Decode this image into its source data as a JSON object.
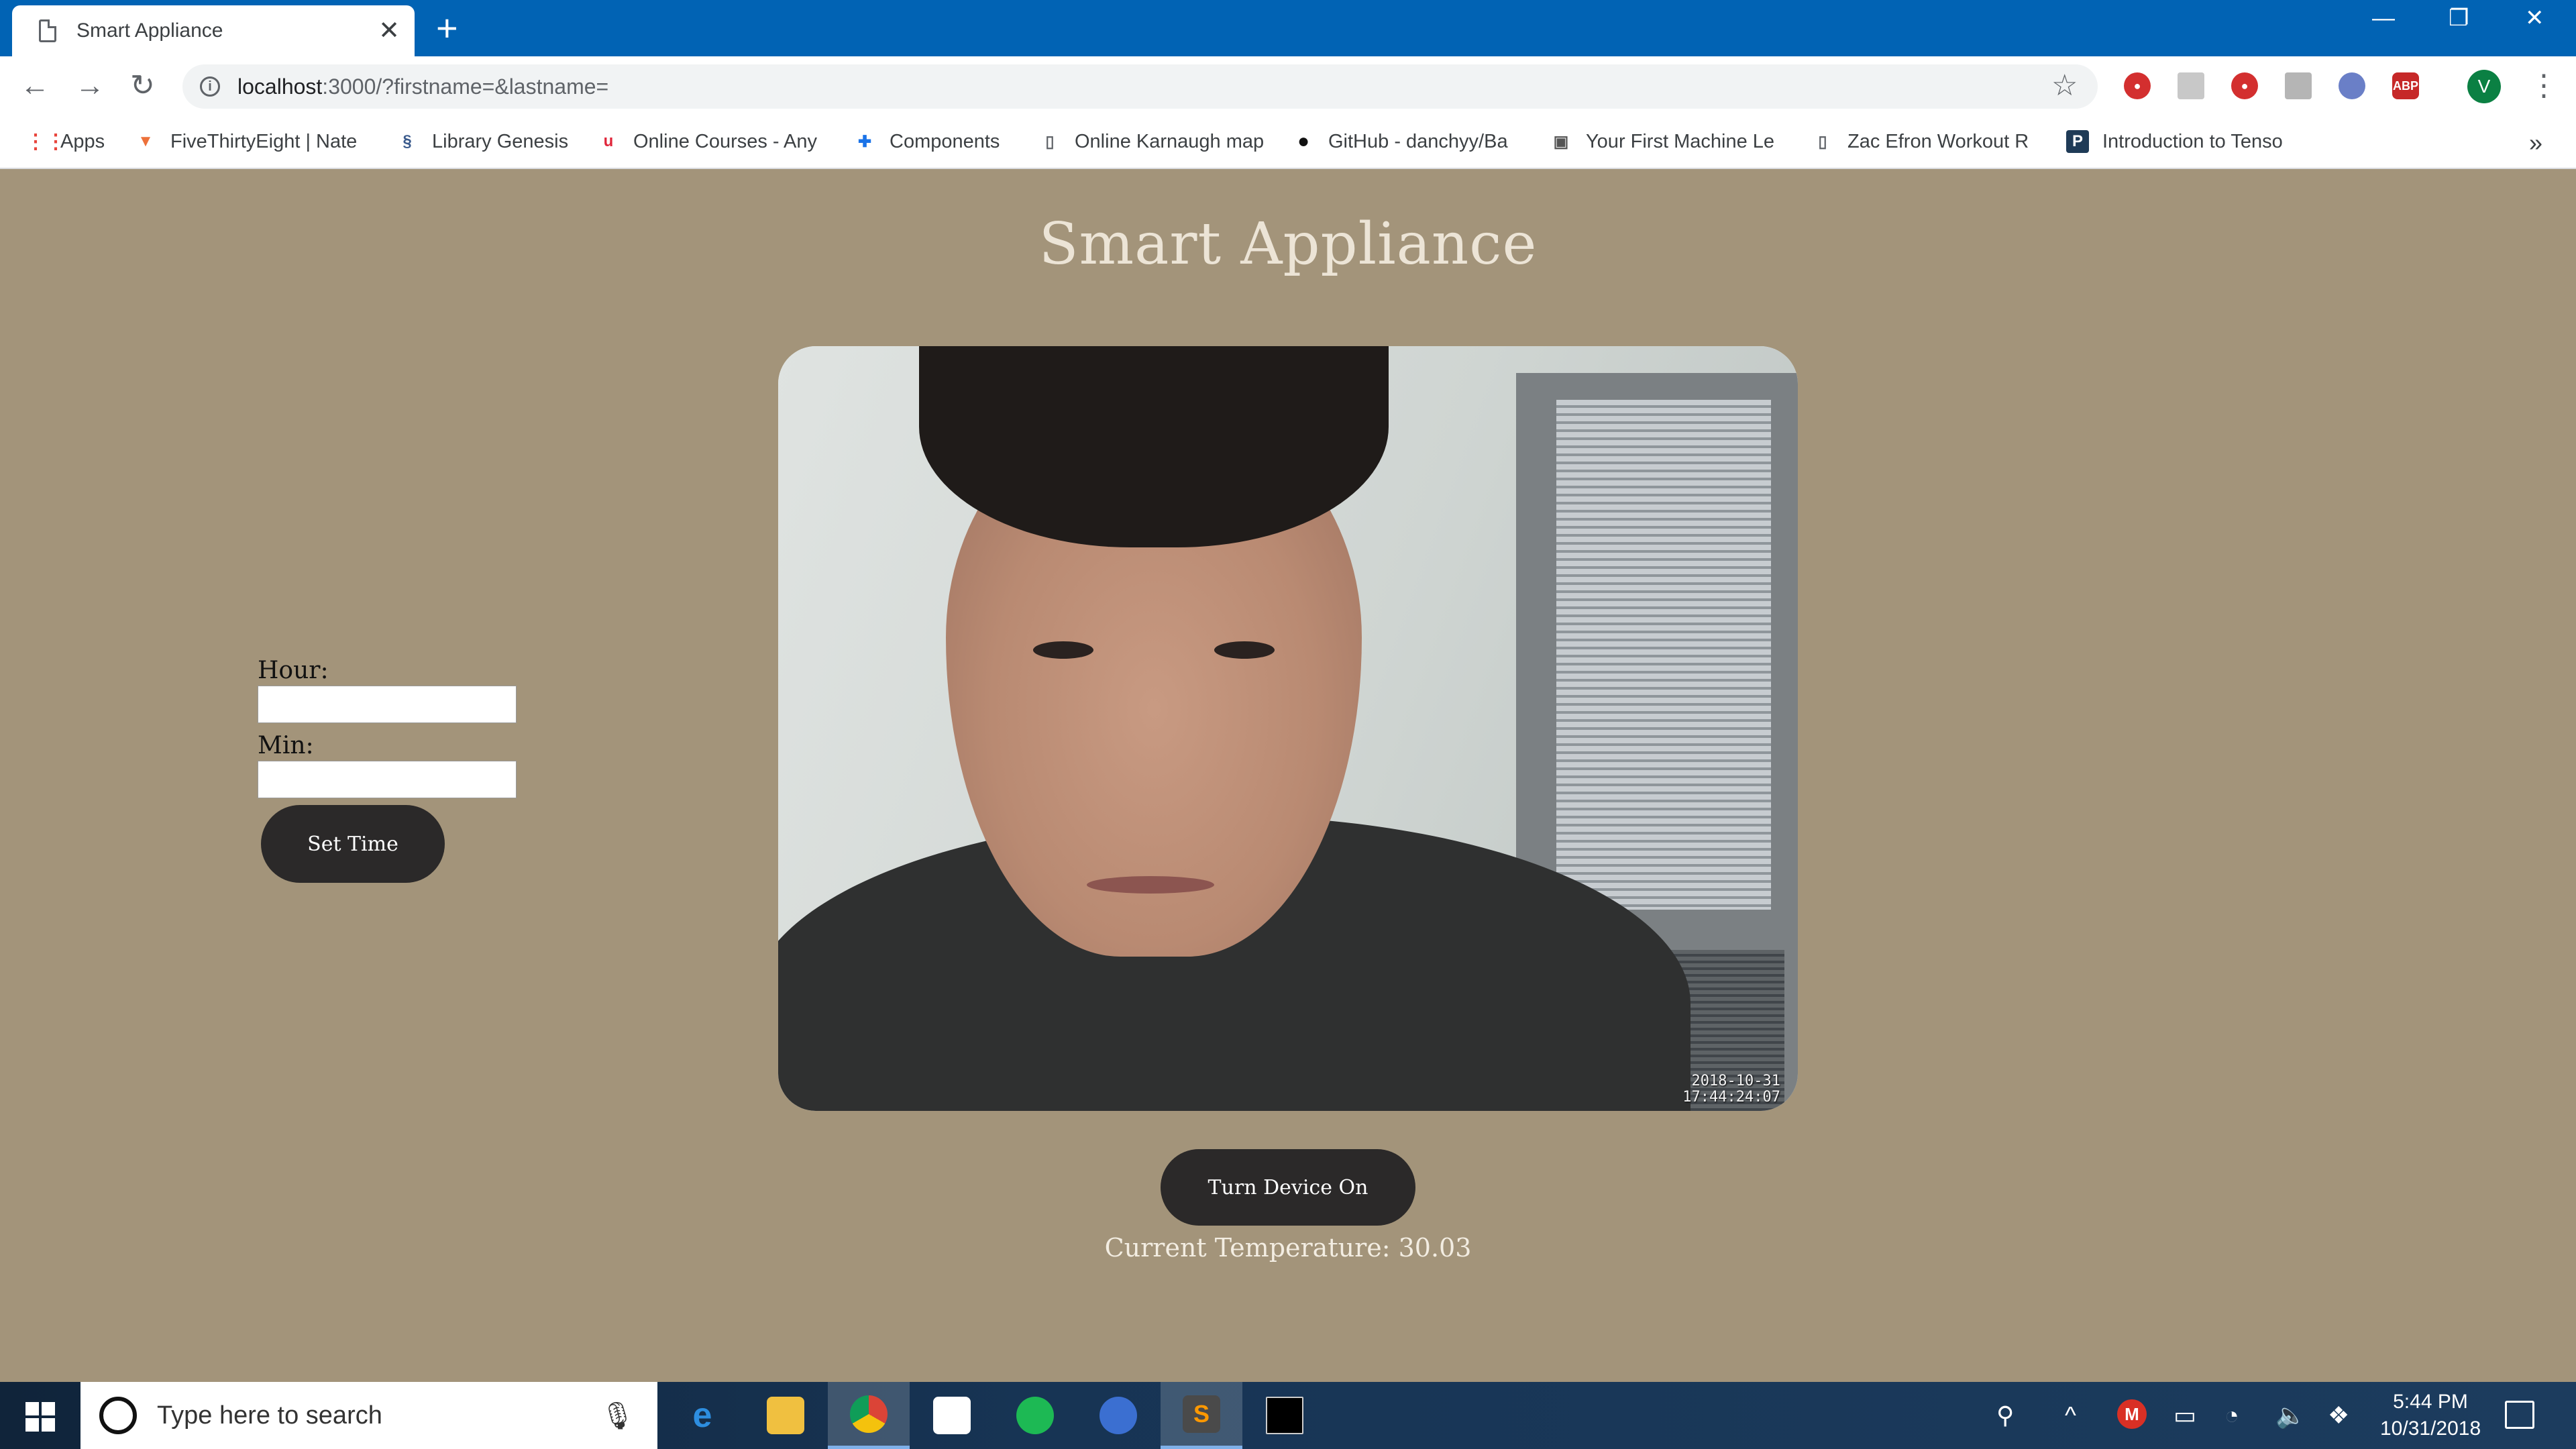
{
  "browser": {
    "tab_title": "Smart Appliance",
    "tab_close": "✕",
    "new_tab": "+",
    "window_controls": {
      "minimize": "—",
      "restore": "❐",
      "close": "✕"
    },
    "url_host": "localhost",
    "url_rest": ":3000/?firstname=&lastname=",
    "profile_initial": "V",
    "extension_abp_label": "ABP",
    "bookmarks": [
      "Apps",
      "FiveThirtyEight | Nate",
      "Library Genesis",
      "Online Courses - Any",
      "Components",
      "Online Karnaugh map",
      "GitHub - danchyy/Ba",
      "Your First Machine Le",
      "Zac Efron Workout R",
      "Introduction to Tenso"
    ],
    "bookmarks_more": "»"
  },
  "page": {
    "title": "Smart Appliance",
    "form": {
      "hour_label": "Hour:",
      "hour_value": "",
      "min_label": "Min:",
      "min_value": "",
      "set_time_button": "Set Time"
    },
    "camera_timestamp_line1": "2018-10-31",
    "camera_timestamp_line2": "17:44:24:07",
    "turn_on_button": "Turn Device On",
    "temperature_text": "Current Temperature: 30.03"
  },
  "taskbar": {
    "search_placeholder": "Type here to search",
    "time": "5:44 PM",
    "date": "10/31/2018",
    "mail_badge": "M"
  },
  "colors": {
    "page_background": "#a3947a",
    "title_color": "#ece4d6",
    "button_dark": "#2b2929",
    "tabstrip_blue": "#0163b4"
  }
}
